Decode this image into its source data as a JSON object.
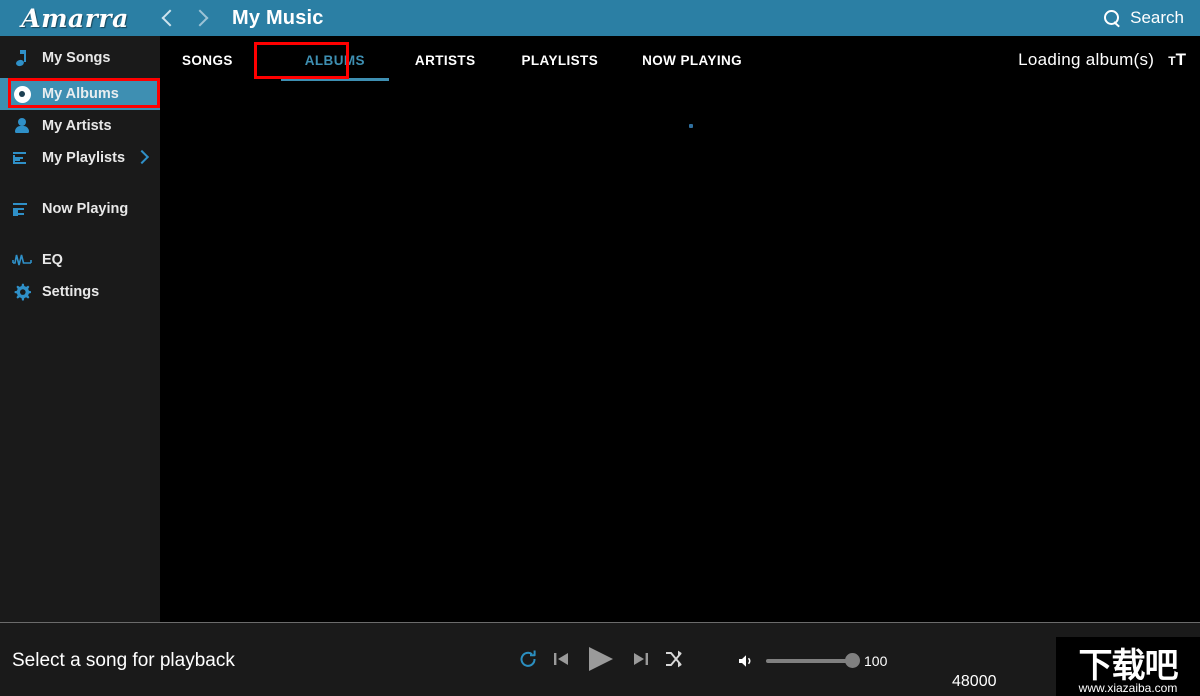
{
  "header": {
    "logo": "Amarra",
    "back_icon": "chevron-left-icon",
    "forward_icon": "chevron-right-icon",
    "title": "My Music",
    "search_label": "Search",
    "search_icon": "search-icon",
    "background": "#2b7fa4"
  },
  "sidebar": {
    "items": [
      {
        "label": "My Songs",
        "icon": "music-note-icon",
        "active": false
      },
      {
        "label": "My Albums",
        "icon": "disc-icon",
        "active": true
      },
      {
        "label": "My Artists",
        "icon": "person-icon",
        "active": false
      },
      {
        "label": "My Playlists",
        "icon": "list-plus-icon",
        "active": false,
        "chevron": "chevron-right-icon"
      },
      {
        "label": "Now Playing",
        "icon": "list-play-icon",
        "active": false
      },
      {
        "label": "EQ",
        "icon": "equalizer-icon",
        "active": false
      },
      {
        "label": "Settings",
        "icon": "gear-icon",
        "active": false
      }
    ],
    "active_color": "#3e8fb2",
    "background": "#1a1a1a"
  },
  "tabs": [
    {
      "label": "SONGS",
      "active": false
    },
    {
      "label": "ALBUMS",
      "active": true
    },
    {
      "label": "ARTISTS",
      "active": false
    },
    {
      "label": "PLAYLISTS",
      "active": false
    },
    {
      "label": "NOW PLAYING",
      "active": false
    }
  ],
  "toolbar": {
    "status": "Loading  album(s)",
    "text_size_icon": "text-size-icon",
    "text_size_small": "T",
    "text_size_large": "T"
  },
  "content": {
    "spinner": "loading-spinner-dot"
  },
  "player": {
    "now_playing_text": "Select a song for playback",
    "repeat_icon": "repeat-icon",
    "previous_icon": "previous-track-icon",
    "play_icon": "play-icon",
    "next_icon": "next-track-icon",
    "shuffle_icon": "shuffle-icon",
    "volume_icon": "volume-icon",
    "volume_value": "100",
    "sample_rate": "48000",
    "accent_color": "#2b8fc0"
  },
  "watermark": {
    "text": "下载吧",
    "url": "www.xiazaiba.com"
  },
  "annotations": {
    "sidebar_highlight": "red-box-my-albums",
    "tab_highlight": "red-box-albums-tab",
    "color": "#ff0000"
  }
}
